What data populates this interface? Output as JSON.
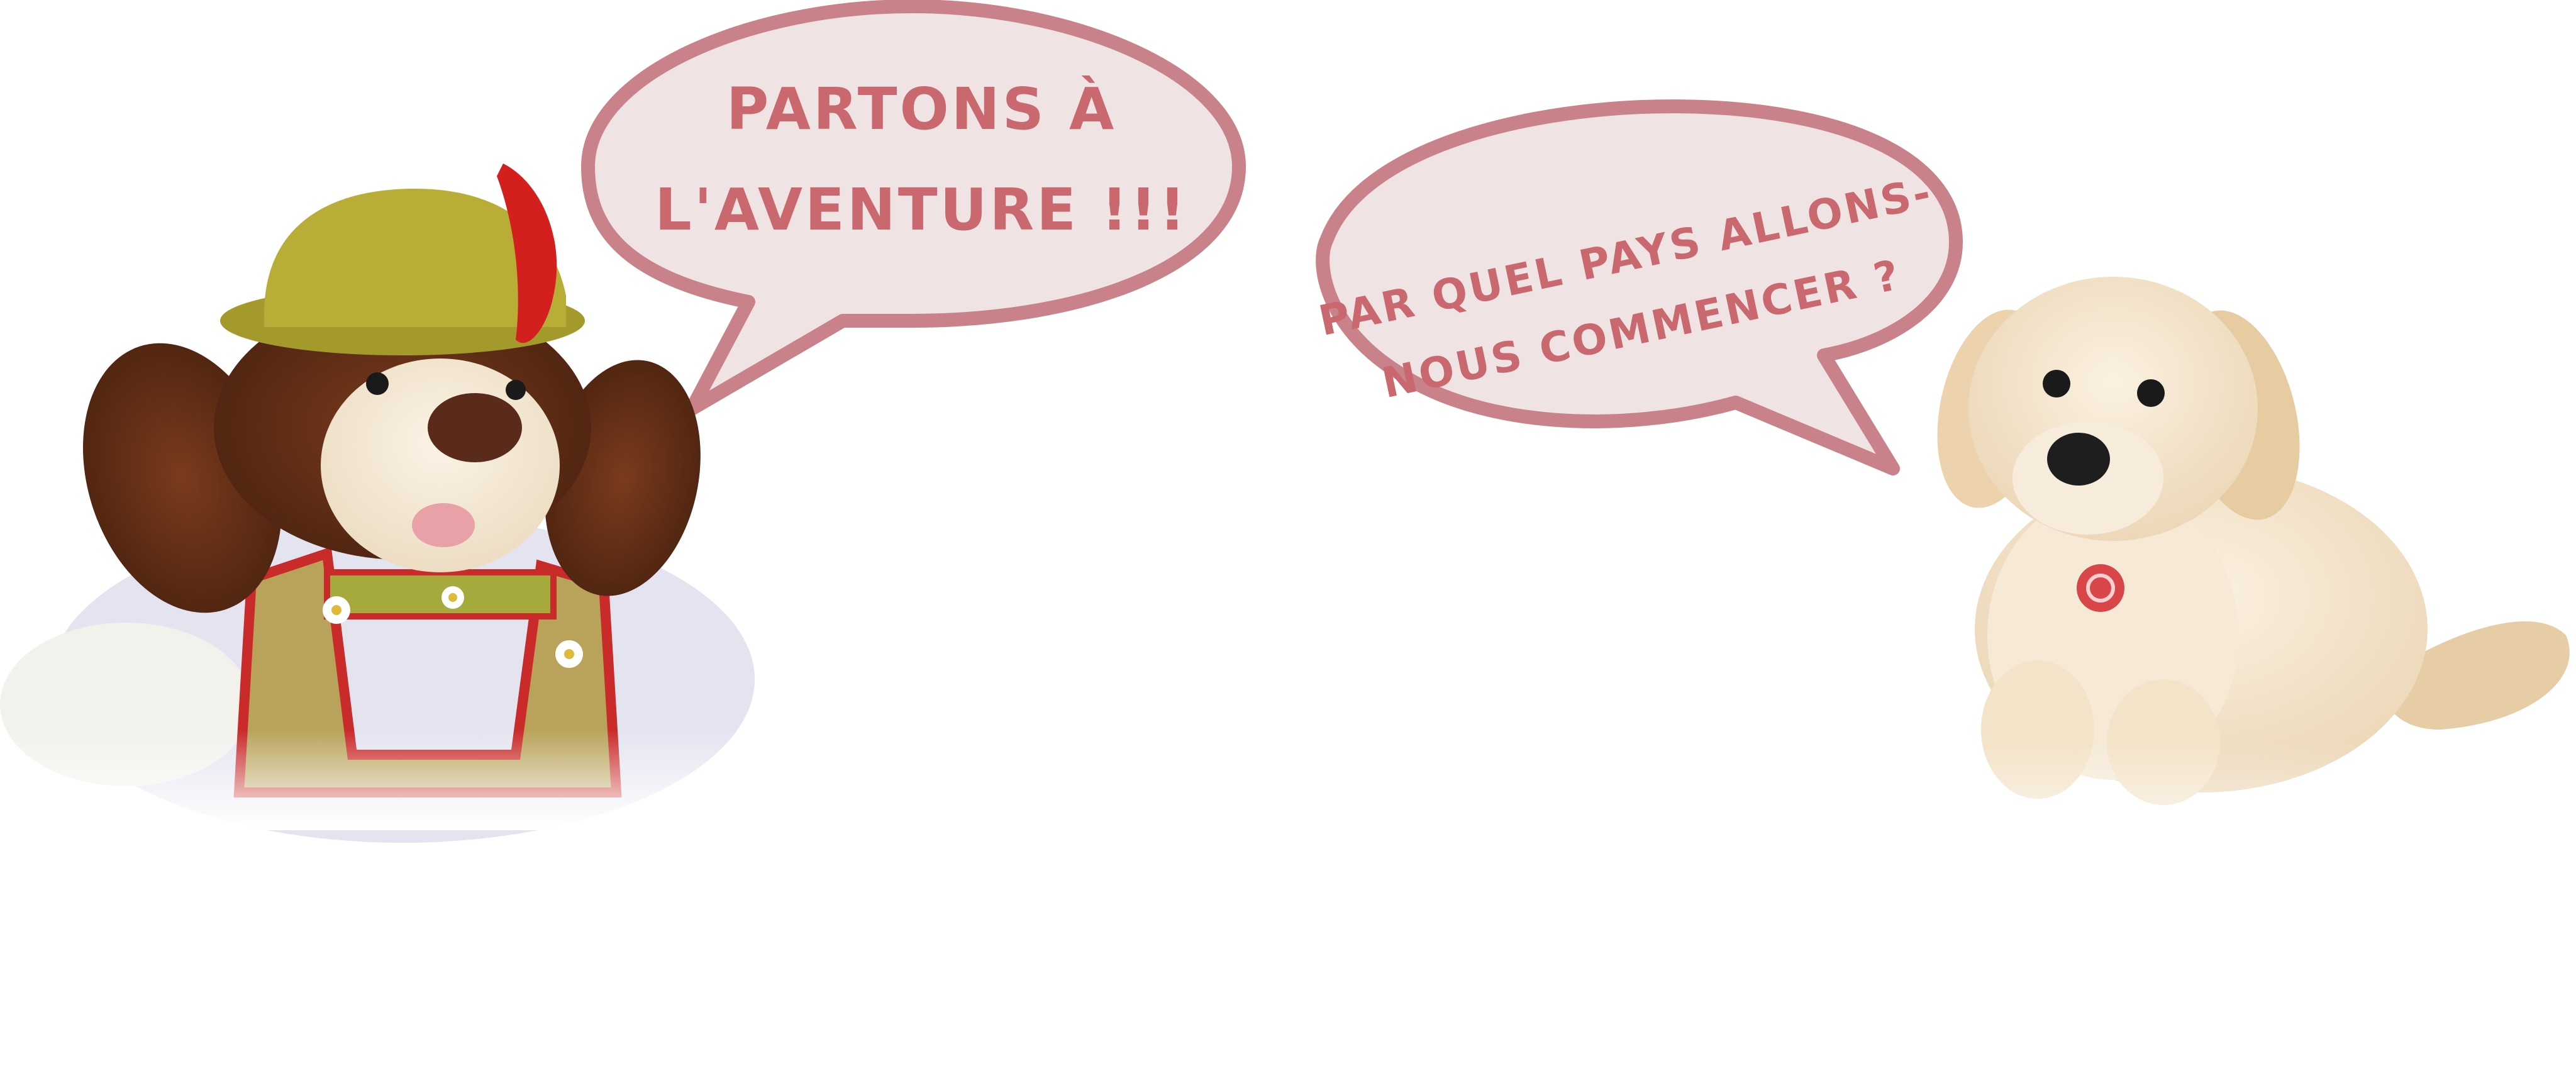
{
  "left_character": {
    "name_icon": "dog-plush-tyrolean-icon",
    "speech": {
      "line1": "PARTONS À",
      "line2": "L'AVENTURE !!!"
    }
  },
  "right_character": {
    "name_icon": "golden-retriever-plush-icon",
    "speech": {
      "line1": "PAR QUEL PAYS ALLONS-",
      "line2": "NOUS COMMENCER ?"
    }
  },
  "colors": {
    "bubble_fill": "#efe3e3",
    "bubble_stroke": "#c9818a",
    "bubble_text": "#c9686e",
    "background": "#ffffff"
  }
}
